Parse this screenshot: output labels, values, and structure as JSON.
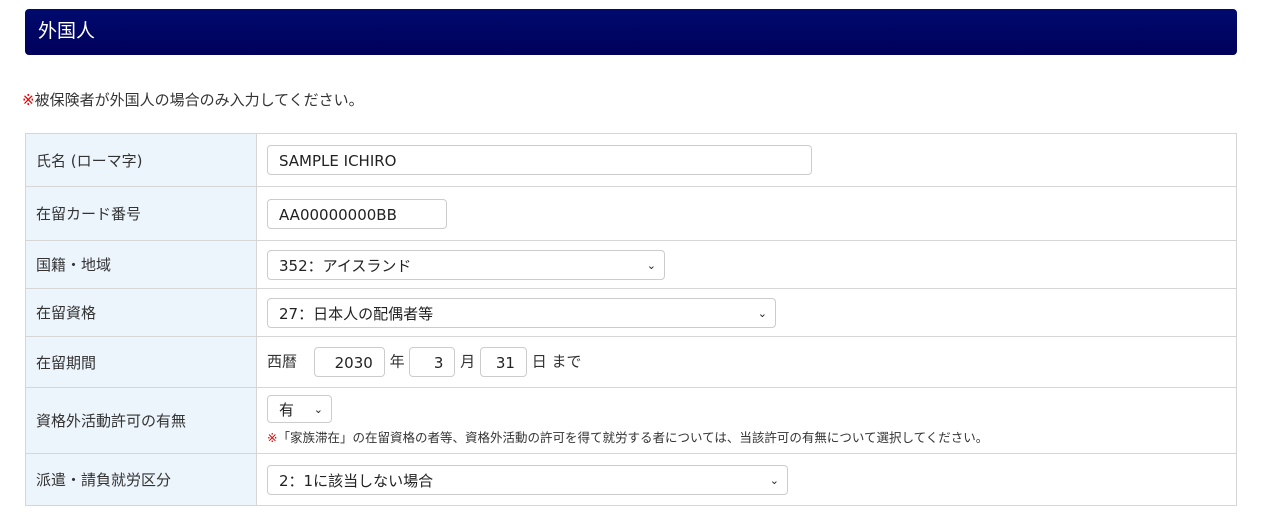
{
  "header": {
    "title": "外国人"
  },
  "note": {
    "mark": "※",
    "text": "被保険者が外国人の場合のみ入力してください。"
  },
  "rows": {
    "name": {
      "label": "氏名 (ローマ字)",
      "value": "SAMPLE ICHIRO"
    },
    "card": {
      "label": "在留カード番号",
      "value": "AA00000000BB"
    },
    "nationality": {
      "label": "国籍・地域",
      "value": "352：アイスランド"
    },
    "status": {
      "label": "在留資格",
      "value": "27：日本人の配偶者等"
    },
    "period": {
      "label": "在留期間",
      "era": "西暦",
      "year": "2030",
      "year_unit": "年",
      "month": "3",
      "month_unit": "月",
      "day": "31",
      "day_unit": "日",
      "until": "まで"
    },
    "permit": {
      "label": "資格外活動許可の有無",
      "value": "有",
      "note_mark": "※",
      "note": "「家族滞在」の在留資格の者等、資格外活動の許可を得て就労する者については、当該許可の有無について選択してください。"
    },
    "dispatch": {
      "label": "派遣・請負就労区分",
      "value": "2：1に該当しない場合"
    }
  }
}
